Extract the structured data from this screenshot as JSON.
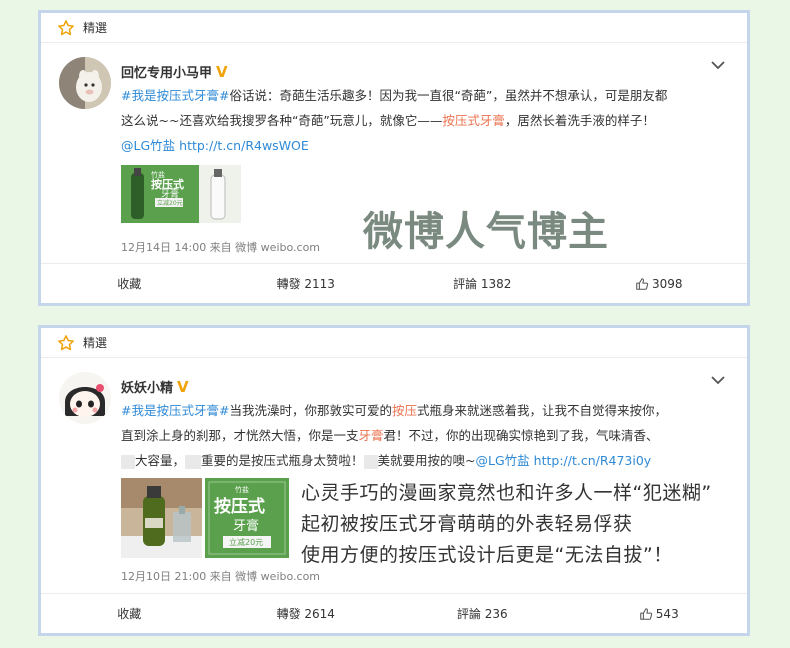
{
  "posts": [
    {
      "tag": "精選",
      "user": "回忆专用小马甲",
      "text": {
        "l1_a": "#我是按压式牙膏#",
        "l1_b": "俗话说：奇葩生活乐趣多！因为我一直很“奇葩”，虽然并不想承认，可是朋友都",
        "l2_a": "这么说~~还喜欢给我搜罗各种“奇葩”玩意儿，就像它——",
        "l2_b": "按压式牙膏",
        "l2_c": "，居然长着洗手液的样子！",
        "l3_a": "@LG竹盐",
        "l3_b": "http://t.cn/R4wsWOE"
      },
      "thumb": {
        "brand": "竹盐",
        "title": "按压式",
        "sub": "牙膏",
        "badge": "立减20元"
      },
      "watermark": "微博人气博主",
      "meta": "12月14日 14:00 来自 微博 weibo.com",
      "actions": {
        "fav": "收藏",
        "repost": "轉發 2113",
        "comment": "評論 1382",
        "like": "3098"
      }
    },
    {
      "tag": "精選",
      "user": "妖妖小精",
      "text": {
        "l1_a": "#我是按压式牙膏#",
        "l1_b": "当我洗澡时，你那敦实可爱的",
        "l1_c": "按压",
        "l1_d": "式瓶身来就迷惑着我，让我不自觉得来按你，",
        "l2_a": "直到涂上身的刹那，才恍然大悟，你是一支",
        "l2_b": "牙膏",
        "l2_c": "君！不过，你的出现确实惊艳到了我，气味清香、",
        "l3_a": "大容量，",
        "l3_b": "重要的是按压式瓶身太赞啦！",
        "l3_c": "美就要用按的噢~",
        "l3_d": "@LG竹盐",
        "l3_e": "http://t.cn/R473i0y"
      },
      "thumb2": {
        "brand": "竹盐",
        "title": "按压式",
        "sub": "牙膏",
        "badge": "立减20元"
      },
      "captions": [
        "心灵手巧的漫画家竟然也和许多人一样“犯迷糊”",
        "起初被按压式牙膏萌萌的外表轻易俘获",
        "使用方便的按压式设计后更是“无法自拔”！"
      ],
      "meta": "12月10日 21:00 来自 微博 weibo.com",
      "actions": {
        "fav": "收藏",
        "repost": "轉發 2614",
        "comment": "評論 236",
        "like": "543"
      }
    }
  ],
  "colors": {
    "background": "#eaf7e6",
    "frame": "#c5d5ec",
    "highlight": "#eb7350",
    "link": "#2f8ad6",
    "vip": "#f0a30a"
  },
  "icons": [
    "star-icon",
    "vip-icon",
    "chevron-down-icon",
    "thumb-up-icon"
  ]
}
